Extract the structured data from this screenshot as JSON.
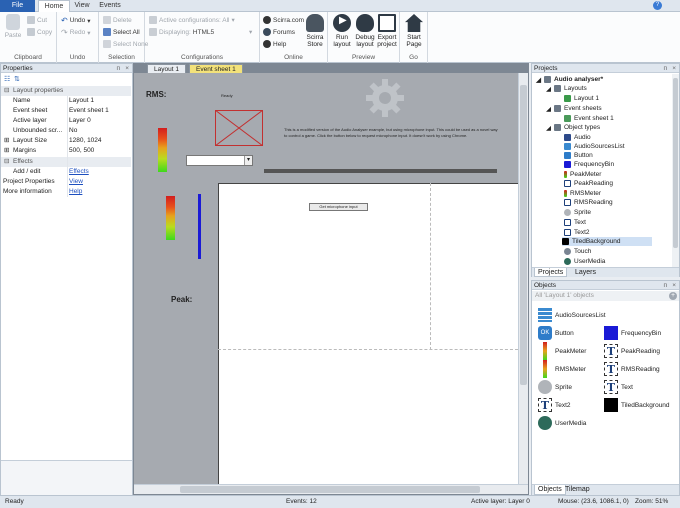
{
  "tabs": {
    "file": "File",
    "home": "Home",
    "view": "View",
    "events": "Events"
  },
  "ribbon": {
    "clipboard": {
      "paste": "Paste",
      "cut": "Cut",
      "copy": "Copy",
      "label": "Clipboard"
    },
    "undo": {
      "undo": "Undo",
      "redo": "Redo",
      "label": "Undo"
    },
    "selection": {
      "delete": "Delete",
      "select_all": "Select All",
      "select_none": "Select None",
      "label": "Selection"
    },
    "configurations": {
      "active": "Active configurations: All",
      "displaying_label": "Displaying:",
      "displaying_value": "HTML5",
      "label": "Configurations"
    },
    "online": {
      "scirra_com": "Scirra.com",
      "forums": "Forums",
      "help": "Help",
      "store_line1": "Scirra",
      "store_line2": "Store",
      "label": "Online"
    },
    "preview": {
      "run_l1": "Run",
      "run_l2": "layout",
      "debug_l1": "Debug",
      "debug_l2": "layout",
      "export_l1": "Export",
      "export_l2": "project",
      "label": "Preview"
    },
    "go": {
      "start_l1": "Start",
      "start_l2": "Page",
      "label": "Go"
    }
  },
  "properties": {
    "title": "Properties",
    "layout_properties": "Layout properties",
    "rows": [
      {
        "k": "Name",
        "v": "Layout 1"
      },
      {
        "k": "Event sheet",
        "v": "Event sheet 1"
      },
      {
        "k": "Active layer",
        "v": "Layer 0"
      },
      {
        "k": "Unbounded scr...",
        "v": "No"
      },
      {
        "k": "Layout Size",
        "v": "1280, 1024"
      },
      {
        "k": "Margins",
        "v": "500, 500"
      }
    ],
    "effects": "Effects",
    "add_edit": "Add / edit",
    "add_edit_link": "Effects",
    "project_properties": "Project Properties",
    "project_link": "View",
    "more_info": "More information",
    "more_link": "Help"
  },
  "doc_tabs": {
    "layout": "Layout 1",
    "events": "Event sheet 1"
  },
  "canvas": {
    "rms_label": "RMS:",
    "ready_text": "Ready",
    "description": "This is a modified version of the Audio Analyser example, but using microphone input. This could be used as a novel way to control a game. Click the button below to request microphone input. It doesn't work by using Chrome.",
    "mic_button": "Get microphone input",
    "peak_label": "Peak:"
  },
  "projects": {
    "title": "Projects",
    "root": "Audio analyser*",
    "layouts": "Layouts",
    "layout1": "Layout 1",
    "event_sheets": "Event sheets",
    "event_sheet1": "Event sheet 1",
    "object_types": "Object types",
    "objects": [
      "Audio",
      "AudioSourcesList",
      "Button",
      "FrequencyBin",
      "PeakMeter",
      "PeakReading",
      "RMSMeter",
      "RMSReading",
      "Sprite",
      "Text",
      "Text2",
      "TiledBackground",
      "Touch",
      "UserMedia"
    ],
    "tab_projects": "Projects",
    "tab_layers": "Layers"
  },
  "objects_panel": {
    "title": "Objects",
    "filter": "All 'Layout 1' objects",
    "items_left": [
      "AudioSourcesList",
      "Button",
      "PeakMeter",
      "RMSMeter",
      "Sprite",
      "Text2",
      "UserMedia"
    ],
    "items_right": [
      "FrequencyBin",
      "PeakReading",
      "RMSReading",
      "Text",
      "TiledBackground"
    ],
    "tab_objects": "Objects",
    "tab_tilemap": "Tilemap"
  },
  "status": {
    "ready": "Ready",
    "events": "Events: 12",
    "active_layer": "Active layer: Layer 0",
    "mouse": "Mouse: (23.6, 1086.1, 0)",
    "zoom": "Zoom: 51%"
  },
  "colors": {
    "accent": "#2a62b3",
    "canvas_bg": "#a6aab0",
    "layout_bg": "#ffffff",
    "meter_blue": "#1a1ad6"
  }
}
